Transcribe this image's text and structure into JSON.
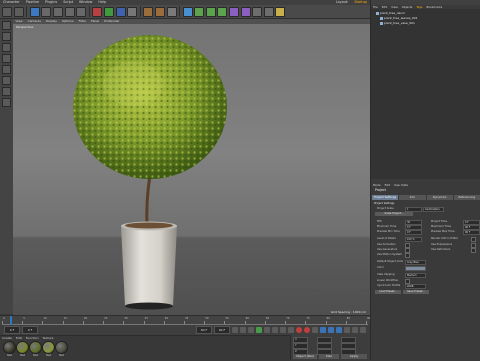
{
  "menubar": {
    "items": [
      "Character",
      "Pipeline",
      "Plugins",
      "Script",
      "Window",
      "Help"
    ],
    "right_items": [
      "Layout:",
      "Startup"
    ]
  },
  "viewport": {
    "menu": [
      "View",
      "Cameras",
      "Display",
      "Options",
      "Filter",
      "Panel",
      "ProRender"
    ],
    "camera_label": "Perspective",
    "status": "Grid Spacing : 1000 cm"
  },
  "object_manager": {
    "menu": [
      "File",
      "Edit",
      "View",
      "Objects",
      "Tags",
      "Bookmarks"
    ],
    "objects": [
      {
        "name": "plant_tree_decor"
      },
      {
        "name": "plant_tree_leaves_001"
      },
      {
        "name": "plant_tree_vase_001"
      }
    ]
  },
  "attribute_manager": {
    "menu": [
      "Mode",
      "Edit",
      "User Data"
    ],
    "title": "Project",
    "tabs": [
      "Project Settings",
      "Info",
      "Dynamics",
      "Referencing"
    ],
    "section": "Project Settings",
    "rows": [
      {
        "label": "Project Scale",
        "value": "1",
        "unit": "Centimeters"
      },
      {
        "label": "FPS",
        "value": "30"
      },
      {
        "label": "Minimum Time",
        "value": "0 F"
      },
      {
        "label": "Preview Min Time",
        "value": "0 F"
      },
      {
        "label": "Level of Detail",
        "value": "100 %"
      },
      {
        "label": "Use Animation"
      },
      {
        "label": "Use Generators"
      },
      {
        "label": "Use Motion System"
      },
      {
        "label": "Default Object Color",
        "value": "Gray Blue"
      },
      {
        "label": "Color"
      },
      {
        "label": "View Clipping",
        "value": "Medium"
      },
      {
        "label": "Linear Workflow"
      },
      {
        "label": "Input Color Profile",
        "value": "sRGB"
      }
    ],
    "rows_right": [
      {
        "label": "Project Time",
        "value": "0 F"
      },
      {
        "label": "Maximum Time",
        "value": "90 F"
      },
      {
        "label": "Preview Max Time",
        "value": "90 F"
      },
      {
        "label": "Render LOD in Editor"
      },
      {
        "label": "Use Expressions"
      },
      {
        "label": "Use Deformers"
      }
    ],
    "buttons": {
      "scale_project": "Scale Project...",
      "load_preset": "Load Preset...",
      "save_preset": "Save Preset..."
    }
  },
  "timeline": {
    "ticks": [
      "0",
      "5",
      "10",
      "15",
      "20",
      "25",
      "30",
      "35",
      "40",
      "45",
      "50",
      "55",
      "60",
      "65",
      "70",
      "75",
      "80",
      "85",
      "90"
    ]
  },
  "transport": {
    "start": "0 F",
    "current": "0 F",
    "end": "90 F",
    "end2": "90 F"
  },
  "material_manager": {
    "menu": [
      "Create",
      "Edit",
      "Function",
      "Texture"
    ],
    "swatches": [
      {
        "name": "Mat",
        "color": "#3b3b2a"
      },
      {
        "name": "Mat",
        "color": "#7a8a2a"
      },
      {
        "name": "Mat",
        "color": "#5f6e26"
      },
      {
        "name": "Mat",
        "color": "#8a9a3a"
      },
      {
        "name": "Mat",
        "color": "#4c4c40"
      }
    ]
  },
  "coordinates": {
    "fields": [
      "X",
      "Y",
      "Z"
    ],
    "apply": "Apply",
    "mode": "Object (Rel)",
    "size": "Size"
  },
  "colors": {
    "accent": "#ffb000",
    "foliage_dark": "#3d5a12",
    "foliage_light": "#b7c845",
    "trunk": "#5a3f26",
    "pot": "#d8d5ce",
    "selected_tab": "#6a7d93"
  },
  "icons": {
    "toolbar": [
      "undo-icon",
      "redo-icon",
      "select-icon",
      "move-icon",
      "scale-icon",
      "rotate-icon",
      "recent-tools-icon",
      "x-axis-icon",
      "y-axis-icon",
      "z-axis-icon",
      "world-coords-icon",
      "render-view-icon",
      "render-picture-viewer-icon",
      "render-settings-icon",
      "cube-icon",
      "spline-pen-icon",
      "subdivision-icon",
      "array-icon",
      "cloner-icon",
      "deformer-icon",
      "floor-icon",
      "camera-icon",
      "light-icon"
    ]
  }
}
